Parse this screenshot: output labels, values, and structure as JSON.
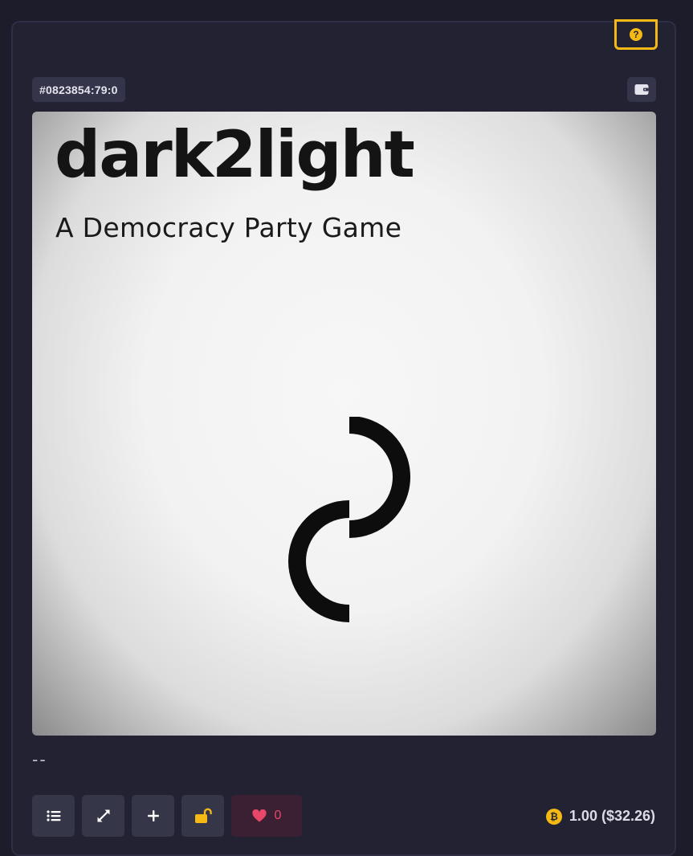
{
  "card": {
    "help_label": "?",
    "inscription_id": "#0823854:79:0",
    "media": {
      "title": "dark2light",
      "subtitle": "A Democracy Party Game"
    },
    "description": "--",
    "actions": {
      "list_icon": "list-icon",
      "expand_icon": "expand-icon",
      "add_label": "+",
      "lock_icon": "unlock-icon",
      "like_count": "0"
    },
    "price": {
      "currency_symbol": "₿",
      "text": "1.00 ($32.26)"
    }
  },
  "colors": {
    "accent": "#f4b915",
    "background": "#1d1c2b",
    "card": "#232233",
    "button": "#363649",
    "like": "#e8476a"
  }
}
